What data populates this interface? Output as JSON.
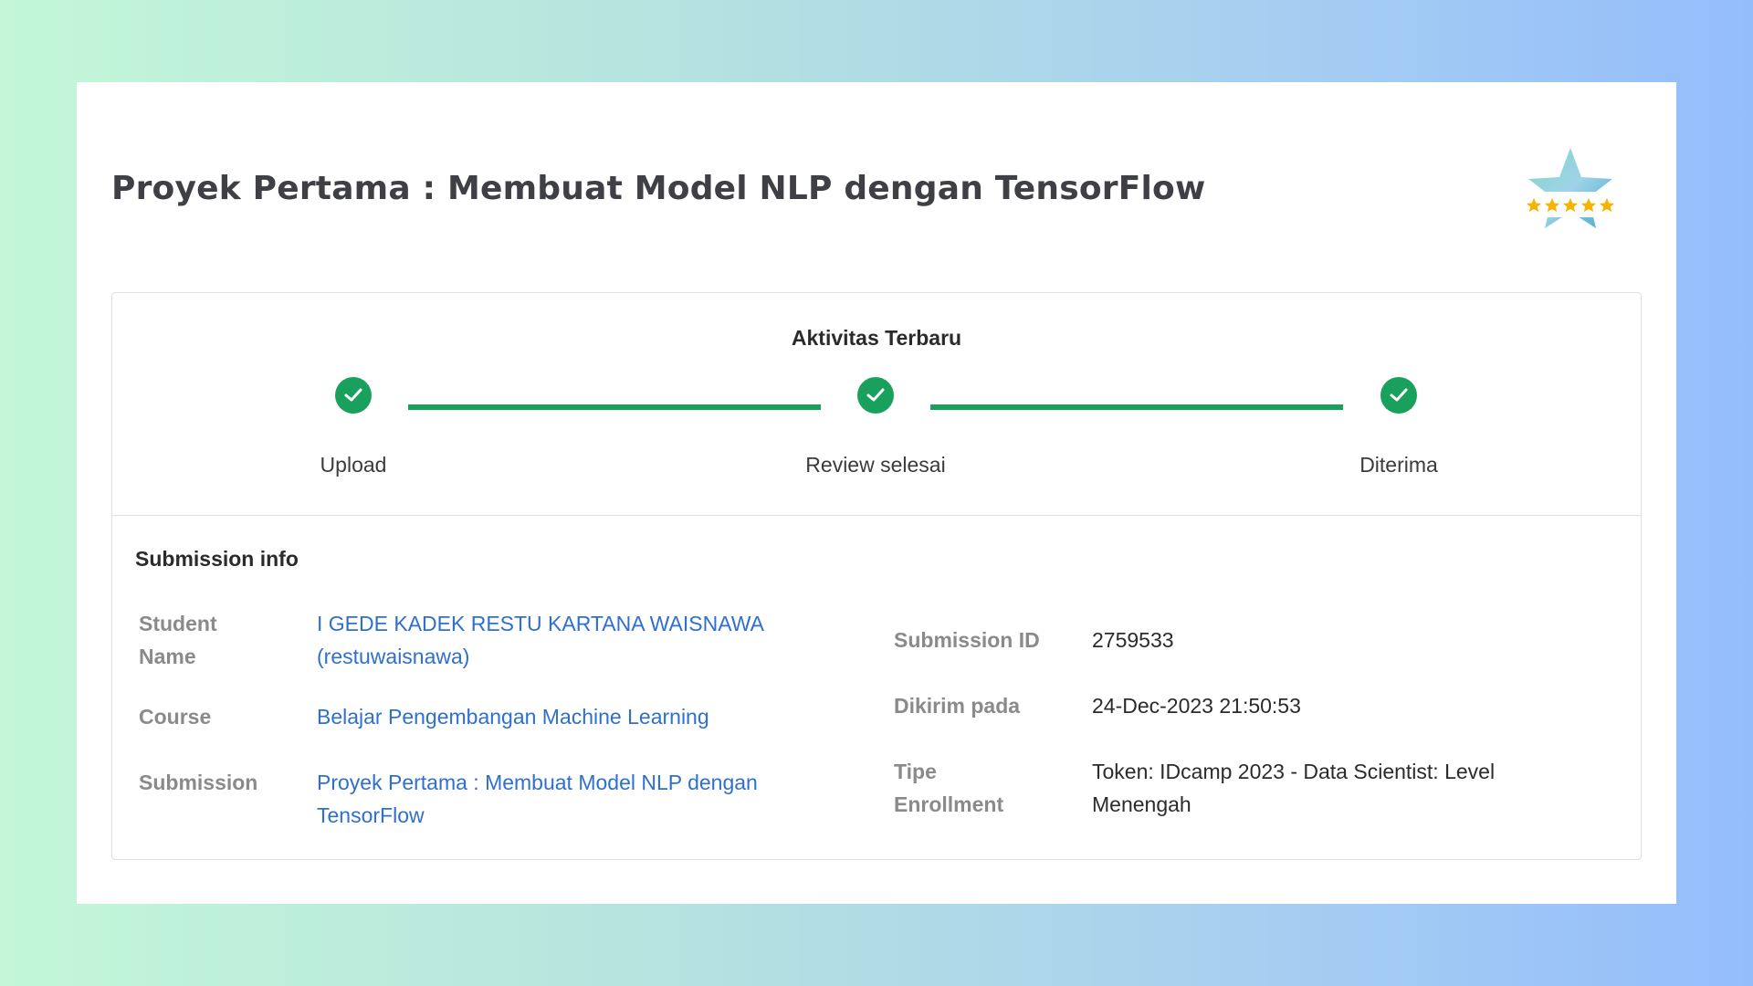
{
  "page": {
    "title": "Proyek Pertama : Membuat Model NLP dengan TensorFlow"
  },
  "colors": {
    "accent_green": "#1aa05d",
    "link_blue": "#2f6fcf",
    "star_yellow": "#f6b400"
  },
  "badge": {
    "icon": "five-star-rating-badge",
    "rating": 5
  },
  "activity": {
    "title": "Aktivitas Terbaru",
    "steps": [
      {
        "label": "Upload",
        "status": "done",
        "icon": "check-icon"
      },
      {
        "label": "Review selesai",
        "status": "done",
        "icon": "check-icon"
      },
      {
        "label": "Diterima",
        "status": "done",
        "icon": "check-icon"
      }
    ]
  },
  "submission_info": {
    "title": "Submission info",
    "student_label": "Student Name",
    "student_value": "I GEDE KADEK RESTU KARTANA WAISNAWA (restuwaisnawa)",
    "course_label": "Course",
    "course_value": "Belajar Pengembangan Machine Learning",
    "submission_label": "Submission",
    "submission_value": "Proyek Pertama : Membuat Model NLP dengan TensorFlow",
    "submission_id_label": "Submission ID",
    "submission_id_value": "2759533",
    "sent_label": "Dikirim pada",
    "sent_value": "24-Dec-2023 21:50:53",
    "enrollment_label": "Tipe Enrollment",
    "enrollment_value": "Token: IDcamp 2023 - Data Scientist: Level Menengah"
  }
}
